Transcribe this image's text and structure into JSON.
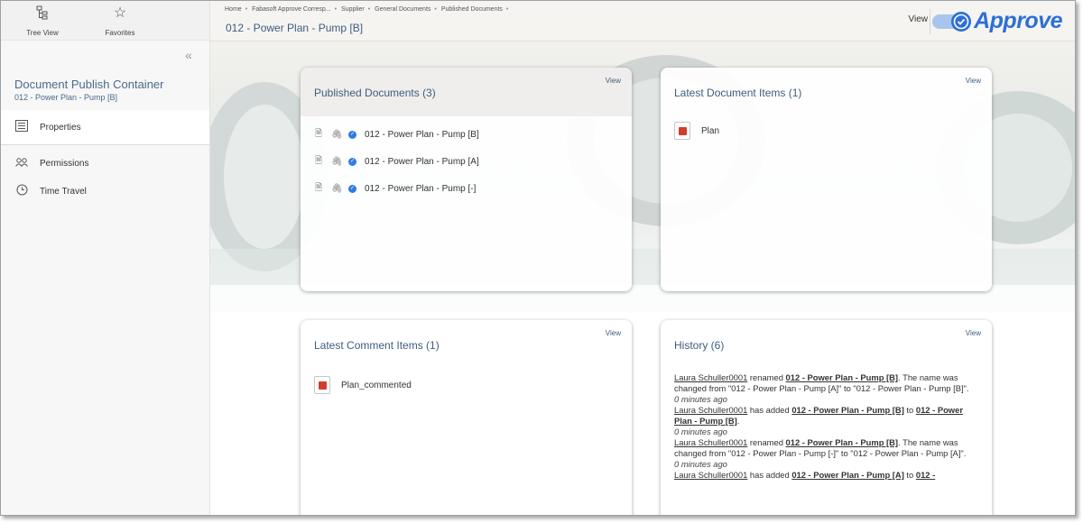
{
  "sidebar": {
    "tree_view_label": "Tree View",
    "favorites_label": "Favorites",
    "collapse_glyph": "«",
    "container_title": "Document Publish Container",
    "container_subtitle": "012 - Power Plan - Pump [B]",
    "items": [
      {
        "label": "Properties",
        "icon": "properties-icon"
      },
      {
        "label": "Permissions",
        "icon": "permissions-icon"
      },
      {
        "label": "Time Travel",
        "icon": "time-travel-icon"
      }
    ]
  },
  "header": {
    "breadcrumbs": [
      "Home",
      "Fabasoft Approve Corresp...",
      "Supplier",
      "General Documents",
      "Published Documents"
    ],
    "title": "012 - Power Plan - Pump [B]",
    "view_label": "View",
    "logo_text": "Approve",
    "brand_color": "#2c6fd6"
  },
  "cards": {
    "published": {
      "title": "Published Documents (3)",
      "view": "View",
      "items": [
        "012 - Power Plan - Pump [B]",
        "012 - Power Plan - Pump [A]",
        "012 - Power Plan - Pump [-]"
      ]
    },
    "latest_docs": {
      "title": "Latest Document Items (1)",
      "view": "View",
      "items": [
        "Plan"
      ]
    },
    "latest_comments": {
      "title": "Latest Comment Items (1)",
      "view": "View",
      "items": [
        "Plan_commented"
      ]
    },
    "history": {
      "title": "History (6)",
      "view": "View",
      "entries": [
        {
          "user": "Laura Schuller0001",
          "action": " renamed ",
          "object": "012 - Power Plan - Pump [B]",
          "rest": ". The name was changed from \"012 - Power Plan - Pump [A]\" to \"012 - Power Plan - Pump [B]\".",
          "ago": "0 minutes ago"
        },
        {
          "user": "Laura Schuller0001",
          "action": " has added ",
          "object": "012 - Power Plan - Pump [B]",
          "mid": " to ",
          "target": "012 - Power Plan - Pump [B]",
          "rest": ".",
          "ago": "0 minutes ago"
        },
        {
          "user": "Laura Schuller0001",
          "action": " renamed ",
          "object": "012 - Power Plan - Pump [B]",
          "rest": ". The name was changed from \"012 - Power Plan - Pump [-]\" to \"012 - Power Plan - Pump [A]\".",
          "ago": "0 minutes ago"
        },
        {
          "user": "Laura Schuller0001",
          "action": " has added ",
          "object": "012 - Power Plan - Pump [A]",
          "mid": " to ",
          "target": "012 -",
          "rest": "",
          "ago": ""
        }
      ]
    }
  }
}
